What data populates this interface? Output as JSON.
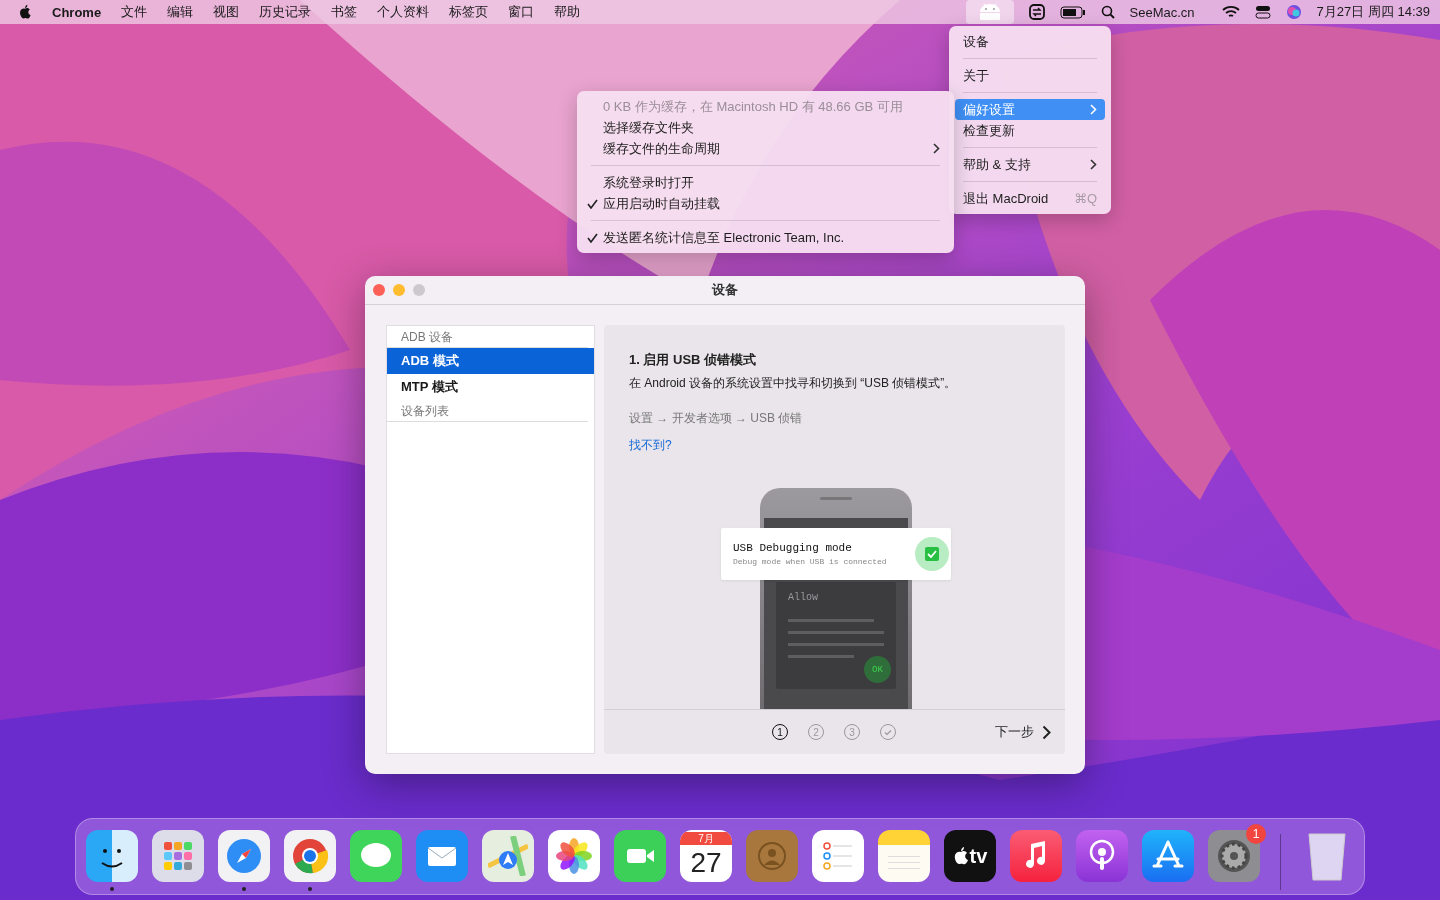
{
  "menubar": {
    "app": "Chrome",
    "menus": [
      "文件",
      "编辑",
      "视图",
      "历史记录",
      "书签",
      "个人资料",
      "标签页",
      "窗口",
      "帮助"
    ],
    "tray_active": true,
    "site": "SeeMac.cn",
    "datetime": "7月27日 周四  14:39"
  },
  "app_menu": {
    "groups": [
      [
        {
          "label": "设备",
          "selected": false,
          "submenu": false
        }
      ],
      [
        {
          "label": "关于",
          "selected": false,
          "submenu": false
        }
      ],
      [
        {
          "label": "偏好设置",
          "selected": true,
          "submenu": true
        },
        {
          "label": "检查更新",
          "selected": false,
          "submenu": false
        }
      ],
      [
        {
          "label": "帮助 & 支持",
          "selected": false,
          "submenu": true
        }
      ],
      [
        {
          "label": "退出 MacDroid",
          "selected": false,
          "submenu": false,
          "shortcut": "⌘Q"
        }
      ]
    ]
  },
  "submenu": {
    "groups": [
      [
        {
          "label": "0 KB 作为缓存，在 Macintosh HD 有 48.66 GB 可用",
          "disabled": true,
          "checked": false,
          "submenu": false
        },
        {
          "label": "选择缓存文件夹",
          "disabled": false,
          "checked": false,
          "submenu": false
        },
        {
          "label": "缓存文件的生命周期",
          "disabled": false,
          "checked": false,
          "submenu": true
        }
      ],
      [
        {
          "label": "系统登录时打开",
          "disabled": false,
          "checked": false,
          "submenu": false
        },
        {
          "label": "应用启动时自动挂载",
          "disabled": false,
          "checked": true,
          "submenu": false
        }
      ],
      [
        {
          "label": "发送匿名统计信息至 Electronic Team, Inc.",
          "disabled": false,
          "checked": true,
          "submenu": false
        }
      ]
    ]
  },
  "window": {
    "title": "设备",
    "sidebar": [
      {
        "kind": "header",
        "label": "ADB 设备"
      },
      {
        "kind": "item",
        "label": "ADB 模式",
        "selected": true
      },
      {
        "kind": "item",
        "label": "MTP 模式",
        "selected": false
      },
      {
        "kind": "header",
        "label": "设备列表"
      }
    ],
    "content": {
      "step_title": "1. 启用 USB 侦错模式",
      "description": "在 Android 设备的系统设置中找寻和切换到 “USB 侦错模式”。",
      "path": "设置 → 开发者选项 → USB 侦错",
      "help_link": "找不到?",
      "illustration": {
        "card_title": "USB Debugging mode",
        "card_subtitle": "Debug mode when USB is connected",
        "toggle_checked": true,
        "dialog_title": "Allow",
        "ok_label": "OK"
      },
      "steps": [
        {
          "kind": "number",
          "label": "1",
          "selected": true
        },
        {
          "kind": "number",
          "label": "2",
          "selected": false
        },
        {
          "kind": "number",
          "label": "3",
          "selected": false
        },
        {
          "kind": "done",
          "selected": false
        }
      ],
      "next": "下一步"
    }
  },
  "dock": {
    "items": [
      {
        "kind": "finder",
        "running": true
      },
      {
        "kind": "launchpad",
        "running": false
      },
      {
        "kind": "safari",
        "running": true
      },
      {
        "kind": "chrome",
        "running": true
      },
      {
        "kind": "messages",
        "running": false
      },
      {
        "kind": "mail",
        "running": false
      },
      {
        "kind": "maps",
        "running": false
      },
      {
        "kind": "photos",
        "running": false
      },
      {
        "kind": "facetime",
        "running": false
      },
      {
        "kind": "calendar",
        "running": false,
        "month": "7月",
        "day": "27"
      },
      {
        "kind": "contacts",
        "running": false
      },
      {
        "kind": "reminders",
        "running": false
      },
      {
        "kind": "notes",
        "running": false
      },
      {
        "kind": "tv",
        "running": false,
        "label": "tv"
      },
      {
        "kind": "music",
        "running": false
      },
      {
        "kind": "podcasts",
        "running": false
      },
      {
        "kind": "appstore",
        "running": false
      },
      {
        "kind": "settings",
        "running": false,
        "badge": "1"
      }
    ],
    "trash": {
      "kind": "trash"
    }
  }
}
